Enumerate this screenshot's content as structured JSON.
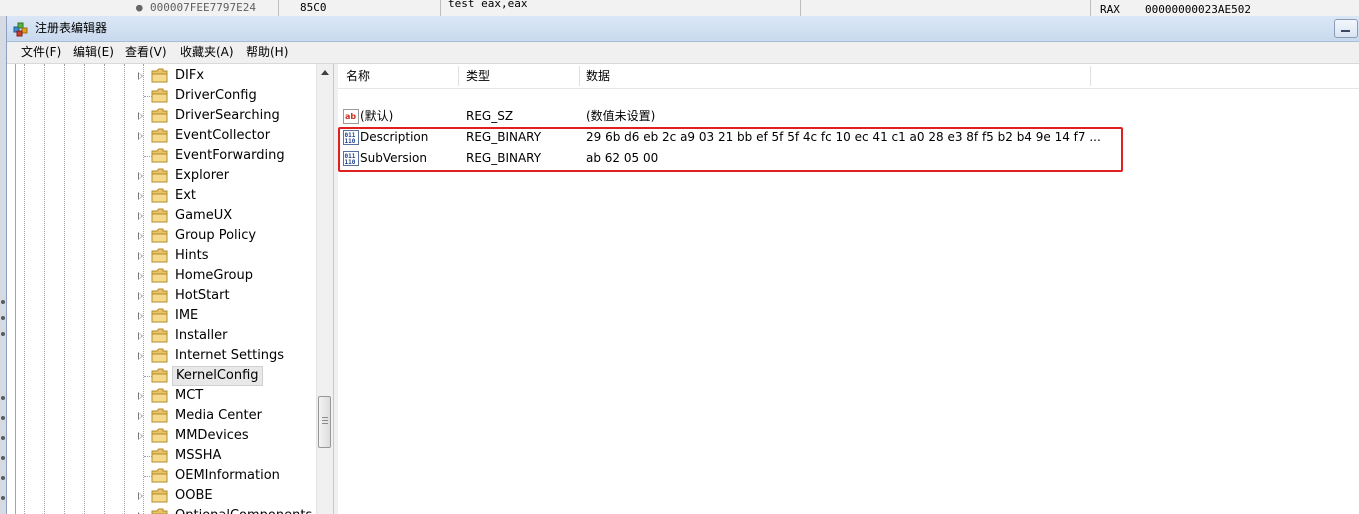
{
  "background_window": {
    "address": "000007FEE7797E24",
    "bytes": "85C0",
    "instruction": "test eax,eax",
    "register_name": "RAX",
    "register_value": "00000000023AE502"
  },
  "window": {
    "title": "注册表编辑器"
  },
  "menu": [
    {
      "label": "文件(F)"
    },
    {
      "label": "编辑(E)"
    },
    {
      "label": "查看(V)"
    },
    {
      "label": "收藏夹(A)"
    },
    {
      "label": "帮助(H)"
    }
  ],
  "tree": {
    "selected": "KernelConfig",
    "items": [
      {
        "label": "DIFx",
        "expandable": true
      },
      {
        "label": "DriverConfig",
        "expandable": false
      },
      {
        "label": "DriverSearching",
        "expandable": true
      },
      {
        "label": "EventCollector",
        "expandable": true
      },
      {
        "label": "EventForwarding",
        "expandable": false
      },
      {
        "label": "Explorer",
        "expandable": true
      },
      {
        "label": "Ext",
        "expandable": true
      },
      {
        "label": "GameUX",
        "expandable": true
      },
      {
        "label": "Group Policy",
        "expandable": true
      },
      {
        "label": "Hints",
        "expandable": true
      },
      {
        "label": "HomeGroup",
        "expandable": true
      },
      {
        "label": "HotStart",
        "expandable": true
      },
      {
        "label": "IME",
        "expandable": true
      },
      {
        "label": "Installer",
        "expandable": true
      },
      {
        "label": "Internet Settings",
        "expandable": true
      },
      {
        "label": "KernelConfig",
        "expandable": false
      },
      {
        "label": "MCT",
        "expandable": true
      },
      {
        "label": "Media Center",
        "expandable": true
      },
      {
        "label": "MMDevices",
        "expandable": true
      },
      {
        "label": "MSSHA",
        "expandable": false
      },
      {
        "label": "OEMInformation",
        "expandable": false
      },
      {
        "label": "OOBE",
        "expandable": true
      },
      {
        "label": "OptionalComponents",
        "expandable": true
      }
    ]
  },
  "list": {
    "columns": [
      "名称",
      "类型",
      "数据"
    ],
    "rows": [
      {
        "name": "(默认)",
        "type": "REG_SZ",
        "data": "(数值未设置)",
        "icon": "string-value-icon"
      },
      {
        "name": "Description",
        "type": "REG_BINARY",
        "data": "29 6b d6 eb 2c a9 03 21 bb ef 5f 5f 4c fc 10 ec 41 c1 a0 28 e3 8f f5 b2 b4 9e 14 f7 ...",
        "icon": "binary-value-icon"
      },
      {
        "name": "SubVersion",
        "type": "REG_BINARY",
        "data": "ab 62 05 00",
        "icon": "binary-value-icon"
      }
    ]
  },
  "highlight": {
    "color": "#e02020"
  }
}
